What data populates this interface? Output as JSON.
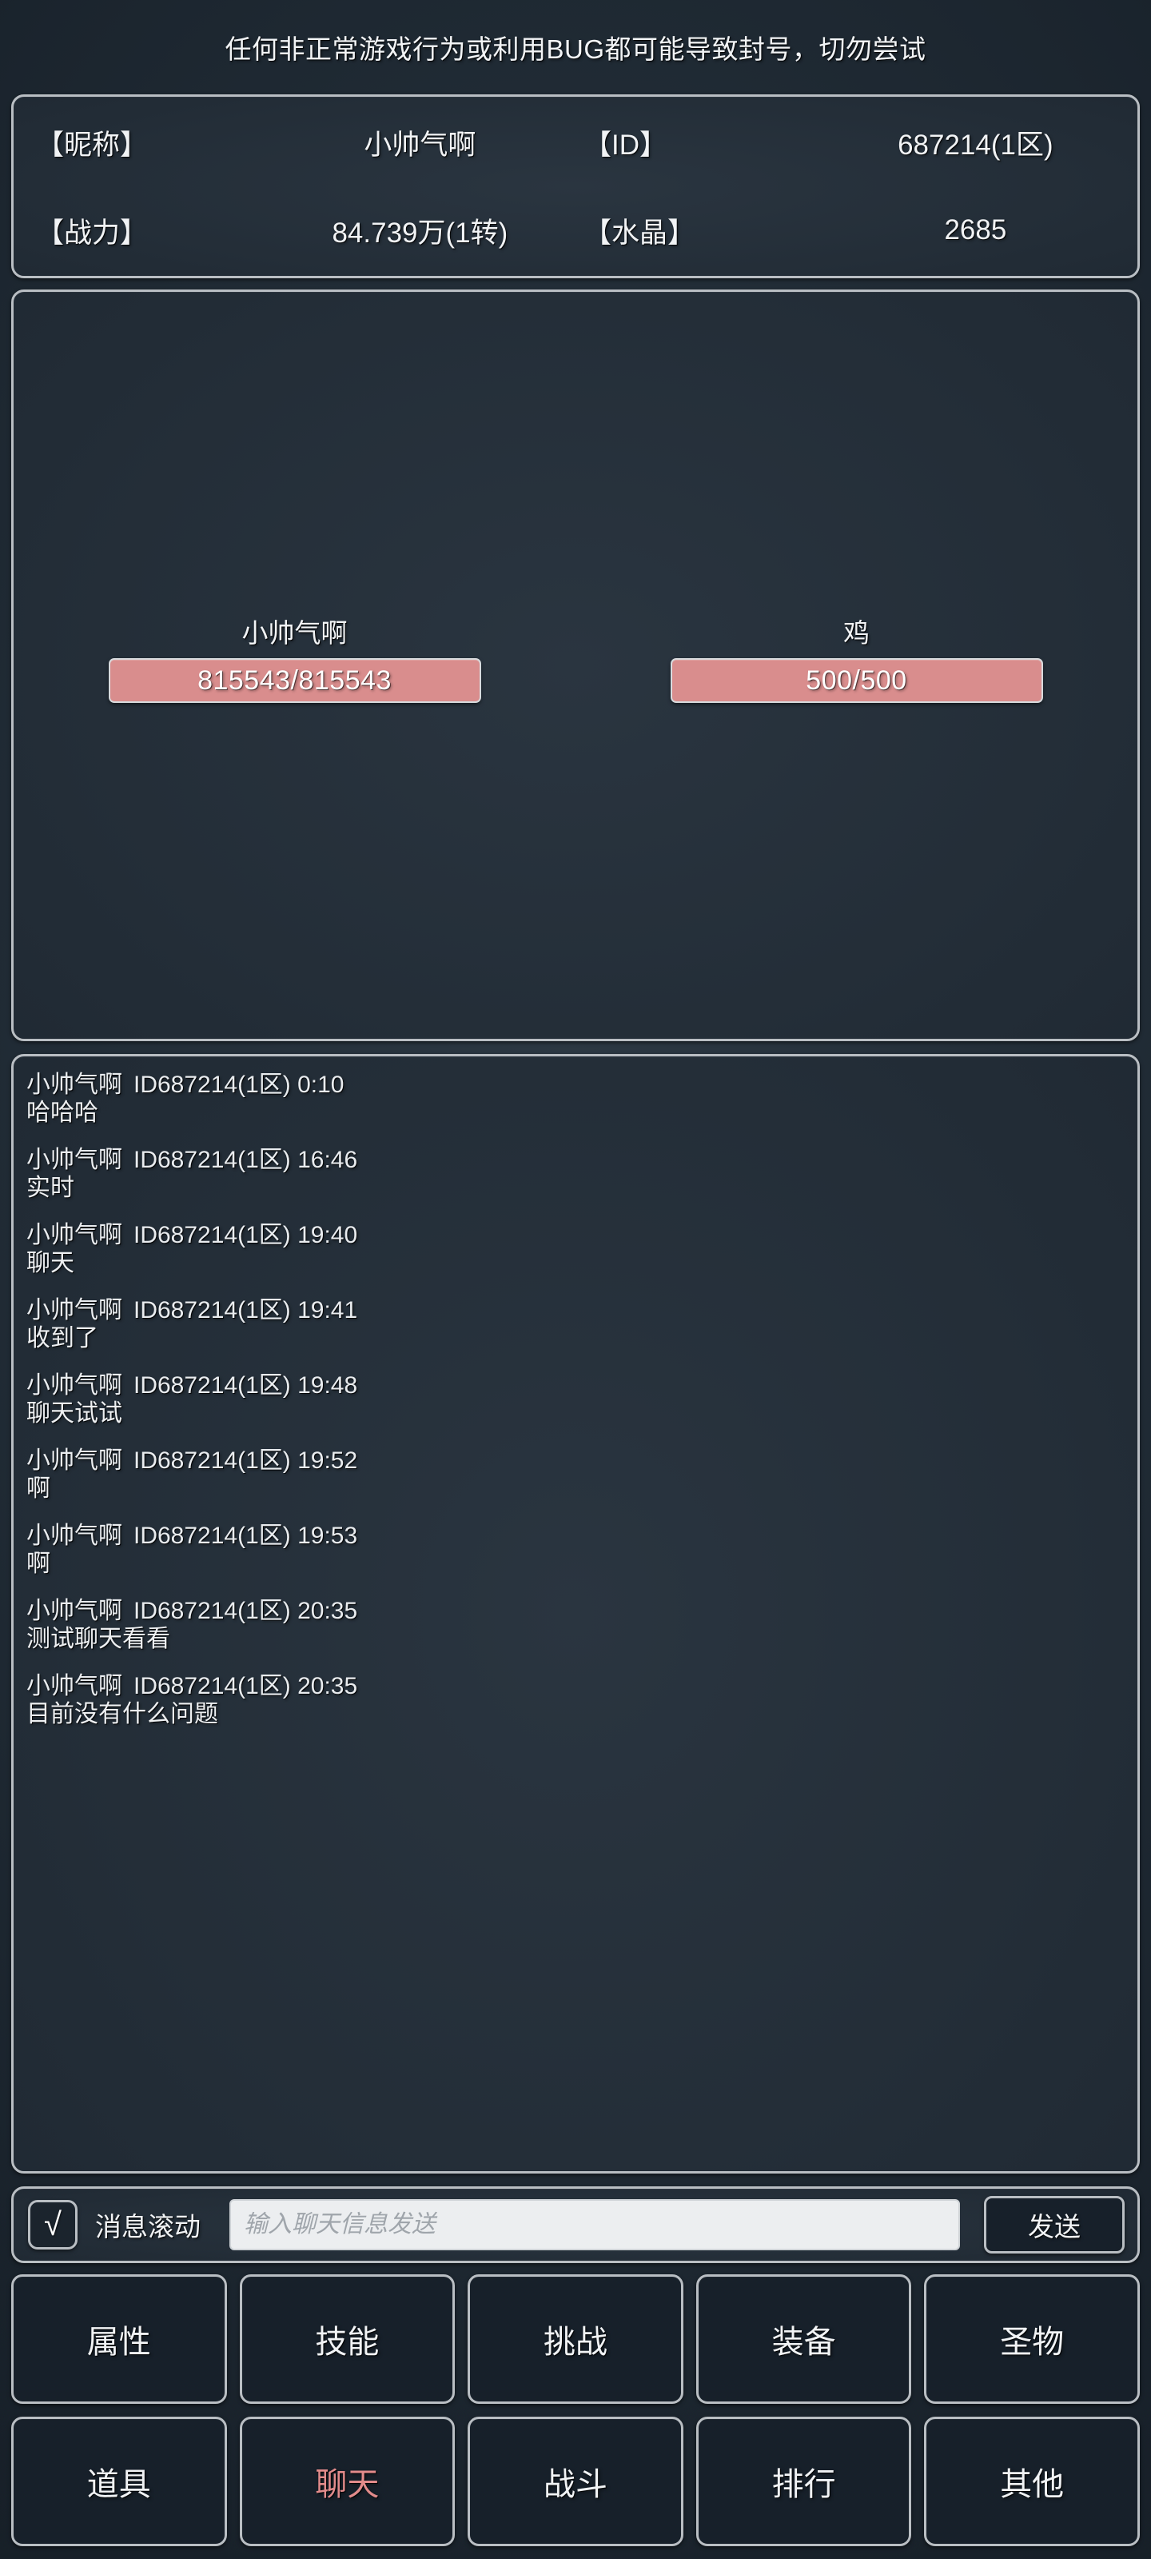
{
  "notice": {
    "text": "任何非正常游戏行为或利用BUG都可能导致封号，切勿尝试"
  },
  "player_info": {
    "nickname_label": "【昵称】",
    "nickname_value": "小帅气啊",
    "id_label": "【ID】",
    "id_value": "687214(1区)",
    "power_label": "【战力】",
    "power_value": "84.739万(1转)",
    "crystal_label": "【水晶】",
    "crystal_value": "2685"
  },
  "battle": {
    "player": {
      "name": "小帅气啊",
      "hp_text": "815543/815543",
      "hp_current": 815543,
      "hp_max": 815543,
      "hp_color": "#d98d8d"
    },
    "enemy": {
      "name": "鸡",
      "hp_text": "500/500",
      "hp_current": 500,
      "hp_max": 500,
      "hp_color": "#d98d8d"
    }
  },
  "chat": {
    "messages": [
      {
        "sender": "小帅气啊",
        "id": "ID687214(1区)",
        "time": "0:10",
        "body": "哈哈哈"
      },
      {
        "sender": "小帅气啊",
        "id": "ID687214(1区)",
        "time": "16:46",
        "body": "实时"
      },
      {
        "sender": "小帅气啊",
        "id": "ID687214(1区)",
        "time": "19:40",
        "body": "聊天"
      },
      {
        "sender": "小帅气啊",
        "id": "ID687214(1区)",
        "time": "19:41",
        "body": "收到了"
      },
      {
        "sender": "小帅气啊",
        "id": "ID687214(1区)",
        "time": "19:48",
        "body": "聊天试试"
      },
      {
        "sender": "小帅气啊",
        "id": "ID687214(1区)",
        "time": "19:52",
        "body": "啊"
      },
      {
        "sender": "小帅气啊",
        "id": "ID687214(1区)",
        "time": "19:53",
        "body": "啊"
      },
      {
        "sender": "小帅气啊",
        "id": "ID687214(1区)",
        "time": "20:35",
        "body": "测试聊天看看"
      },
      {
        "sender": "小帅气啊",
        "id": "ID687214(1区)",
        "time": "20:35",
        "body": "目前没有什么问题"
      }
    ]
  },
  "input_bar": {
    "checkbox_mark": "√",
    "checkbox_checked": true,
    "scroll_label": "消息滚动",
    "input_value": "",
    "input_placeholder": "输入聊天信息发送",
    "send_label": "发送"
  },
  "nav": {
    "buttons": [
      {
        "label": "属性",
        "active": false
      },
      {
        "label": "技能",
        "active": false
      },
      {
        "label": "挑战",
        "active": false
      },
      {
        "label": "装备",
        "active": false
      },
      {
        "label": "圣物",
        "active": false
      },
      {
        "label": "道具",
        "active": false
      },
      {
        "label": "聊天",
        "active": true
      },
      {
        "label": "战斗",
        "active": false
      },
      {
        "label": "排行",
        "active": false
      },
      {
        "label": "其他",
        "active": false
      }
    ],
    "active_color": "#e28b8b"
  }
}
